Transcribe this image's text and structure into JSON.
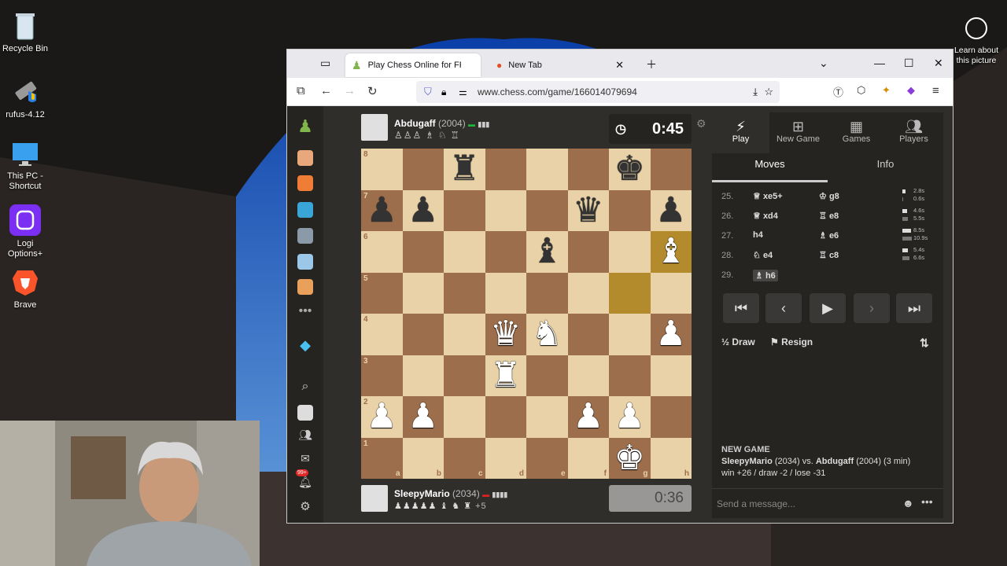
{
  "desktop": {
    "icons": [
      {
        "label": "Recycle Bin",
        "icon": "recycle-bin-icon"
      },
      {
        "label": "rufus-4.12",
        "icon": "usb-drive-icon"
      },
      {
        "label": "This PC - Shortcut",
        "icon": "monitor-icon"
      },
      {
        "label": "Logi Options+",
        "icon": "logi-icon"
      },
      {
        "label": "Brave",
        "icon": "brave-lion-icon"
      }
    ],
    "learn": "Learn about this picture"
  },
  "browser": {
    "tabs": [
      {
        "title": "Play Chess Online for FREE",
        "active": true
      },
      {
        "title": "New Tab",
        "active": false
      }
    ],
    "url": "www.chess.com/game/166014079694"
  },
  "game": {
    "top_player": {
      "name": "Abdugaff",
      "rating": "(2004)",
      "clock": "0:45"
    },
    "bottom_player": {
      "name": "SleepyMario",
      "rating": "(2034)",
      "clock": "0:36",
      "advantage": "+5"
    },
    "board": [
      [
        "",
        "",
        "r",
        "",
        "",
        "",
        "k",
        ""
      ],
      [
        "p",
        "p",
        "",
        "",
        "",
        "q",
        "",
        "p"
      ],
      [
        "",
        "",
        "",
        "",
        "b",
        "",
        "",
        "B"
      ],
      [
        "",
        "",
        "",
        "",
        "",
        "",
        "",
        ""
      ],
      [
        "",
        "",
        "",
        "Q",
        "N",
        "",
        "",
        "P"
      ],
      [
        "",
        "",
        "",
        "R",
        "",
        "",
        "",
        ""
      ],
      [
        "P",
        "P",
        "",
        "",
        "",
        "P",
        "P",
        ""
      ],
      [
        "",
        "",
        "",
        "",
        "",
        "",
        "K",
        ""
      ]
    ],
    "highlights": [
      "g5",
      "h6"
    ],
    "ranks": [
      "8",
      "7",
      "6",
      "5",
      "4",
      "3",
      "2",
      "1"
    ],
    "files": [
      "a",
      "b",
      "c",
      "d",
      "e",
      "f",
      "g",
      "h"
    ]
  },
  "panel": {
    "tabs": [
      {
        "label": "Play",
        "icon": "lightning-icon"
      },
      {
        "label": "New Game",
        "icon": "plus-square-icon"
      },
      {
        "label": "Games",
        "icon": "board-icon"
      },
      {
        "label": "Players",
        "icon": "players-icon"
      }
    ],
    "subtabs": [
      "Moves",
      "Info"
    ],
    "moves": [
      {
        "n": "25.",
        "w": "xe5+",
        "wp": "♕",
        "b": "g8",
        "bp": "♔",
        "t1": "2.8s",
        "t2": "0.6s"
      },
      {
        "n": "26.",
        "w": "xd4",
        "wp": "♕",
        "b": "e8",
        "bp": "♖",
        "t1": "4.6s",
        "t2": "5.5s"
      },
      {
        "n": "27.",
        "w": "h4",
        "wp": "",
        "b": "e6",
        "bp": "♗",
        "t1": "8.5s",
        "t2": "10.9s"
      },
      {
        "n": "28.",
        "w": "e4",
        "wp": "♘",
        "b": "c8",
        "bp": "♖",
        "t1": "5.4s",
        "t2": "6.6s"
      },
      {
        "n": "29.",
        "w": "h6",
        "wp": "♗",
        "b": "",
        "bp": "",
        "t1": "",
        "t2": ""
      }
    ],
    "draw": "Draw",
    "resign": "Resign",
    "new_game_title": "NEW GAME",
    "new_game_line1_a": "SleepyMario",
    "new_game_line1_b": "(2034) vs.",
    "new_game_line1_c": "Abdugaff",
    "new_game_line1_d": "(2004) (3 min)",
    "new_game_line2": "win +26 / draw -2 / lose -31",
    "chat_placeholder": "Send a message..."
  },
  "sidebar": {
    "badge": "99+"
  }
}
